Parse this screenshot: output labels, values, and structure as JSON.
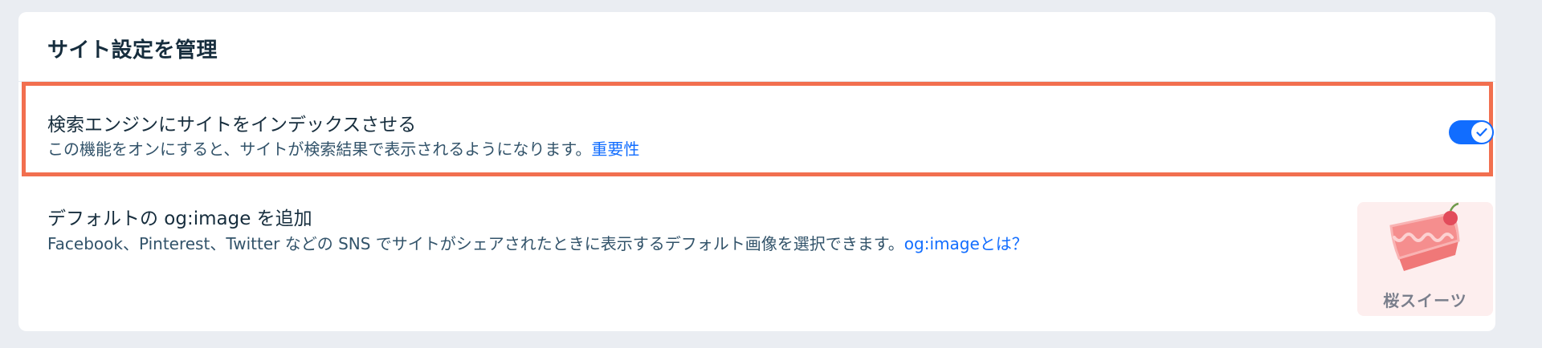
{
  "card": {
    "title": "サイト設定を管理"
  },
  "index_setting": {
    "title": "検索エンジンにサイトをインデックスさせる",
    "description": "この機能をオンにすると、サイトが検索結果で表示されるようになります。",
    "link_text": "重要性",
    "toggle_state": "on"
  },
  "og_image_setting": {
    "title": "デフォルトの og:image を追加",
    "description": "Facebook、Pinterest、Twitter などの SNS でサイトがシェアされたときに表示するデフォルト画像を選択できます。",
    "link_text": "og:imageとは？",
    "thumbnail_label": "桜スイーツ"
  },
  "colors": {
    "accent": "#116dff",
    "highlight_border": "#f26f4f",
    "title_text": "#162d3d",
    "secondary_text": "#32536a",
    "background": "#eaedf2"
  },
  "icons": {
    "toggle_check": "check-icon",
    "thumbnail_art": "cake-icon"
  }
}
